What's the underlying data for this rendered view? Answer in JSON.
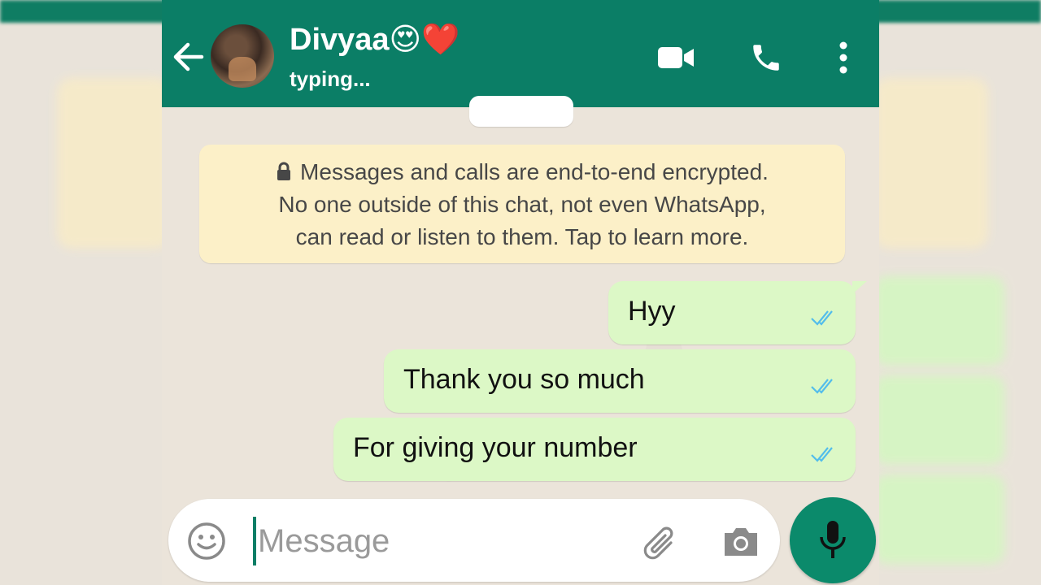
{
  "header": {
    "contact_name": "Divyaa😍❤️",
    "status": "typing...",
    "icons": [
      "back-arrow-icon",
      "video-call-icon",
      "voice-call-icon",
      "more-vert-icon"
    ]
  },
  "encryption_notice": {
    "line1": "Messages and calls are end-to-end encrypted.",
    "line2": "No one outside of this chat, not even WhatsApp,",
    "line3": "can read or listen to them. Tap to learn more."
  },
  "messages": [
    {
      "text": "Hyy",
      "direction": "outgoing",
      "status": "read"
    },
    {
      "text": "Thank you so much",
      "direction": "outgoing",
      "status": "read"
    },
    {
      "text": "For giving your number",
      "direction": "outgoing",
      "status": "read"
    }
  ],
  "composer": {
    "placeholder": "Message",
    "icons": [
      "emoji-icon",
      "attach-icon",
      "camera-icon",
      "mic-icon"
    ]
  },
  "colors": {
    "header": "#0b7e66",
    "outgoing_bubble": "#dcf8c6",
    "notice_bg": "#fcf0c8",
    "read_tick": "#53bdeb",
    "mic_button": "#0b8a6b"
  }
}
